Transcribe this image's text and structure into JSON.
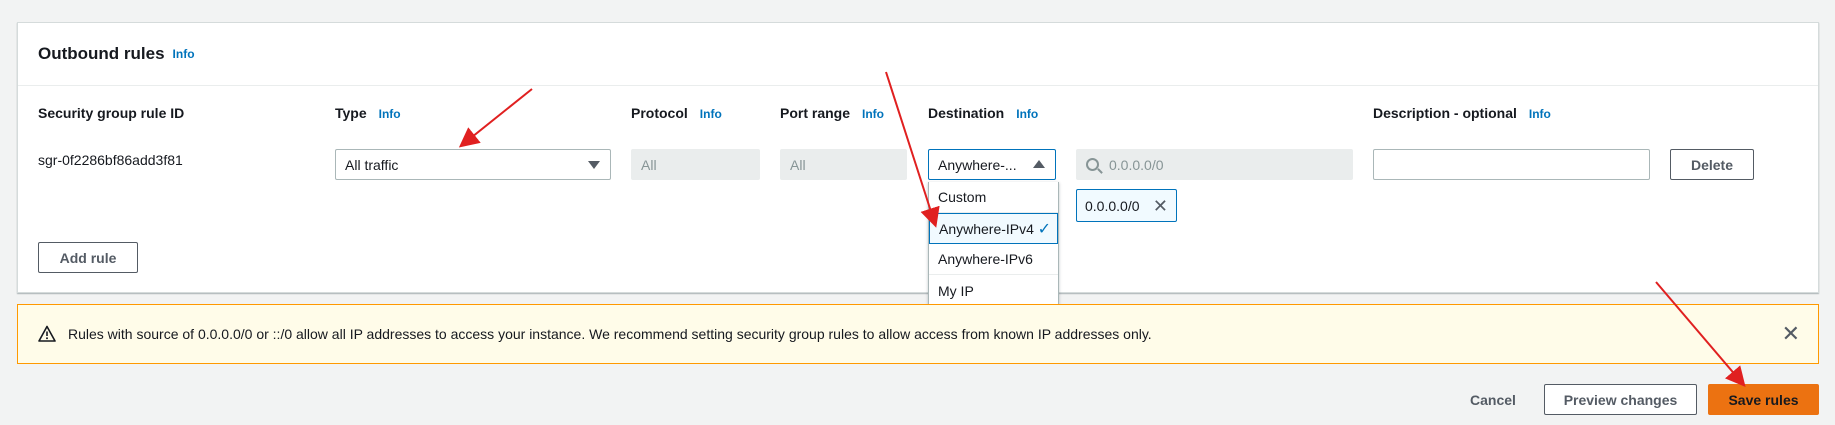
{
  "panel": {
    "title": "Outbound rules",
    "info": "Info"
  },
  "columns": {
    "rule_id": "Security group rule ID",
    "type": "Type",
    "protocol": "Protocol",
    "port_range": "Port range",
    "destination": "Destination",
    "description": "Description - optional",
    "info": "Info"
  },
  "rule": {
    "id": "sgr-0f2286bf86add3f81",
    "type": "All traffic",
    "protocol_placeholder": "All",
    "port_placeholder": "All",
    "destination_value": "Anywhere-...",
    "cidr_placeholder": "0.0.0.0/0",
    "cidr_token": "0.0.0.0/0",
    "description_value": "",
    "delete_label": "Delete"
  },
  "destination_options": [
    {
      "label": "Custom"
    },
    {
      "label": "Anywhere-IPv4",
      "selected": true
    },
    {
      "label": "Anywhere-IPv6"
    },
    {
      "label": "My IP"
    }
  ],
  "add_rule_label": "Add rule",
  "alert": {
    "text": "Rules with source of 0.0.0.0/0 or ::/0 allow all IP addresses to access your instance. We recommend setting security group rules to allow access from known IP addresses only."
  },
  "footer": {
    "cancel": "Cancel",
    "preview": "Preview changes",
    "save": "Save rules"
  },
  "icons": {
    "check": "check-icon",
    "close": "close-icon",
    "warning": "warning-icon",
    "search": "search-icon",
    "caret": "caret-icon"
  },
  "colors": {
    "primary": "#ec7211",
    "link": "#0073bb",
    "annotation_arrow": "#e02020",
    "warning_bg": "#fffce9"
  }
}
